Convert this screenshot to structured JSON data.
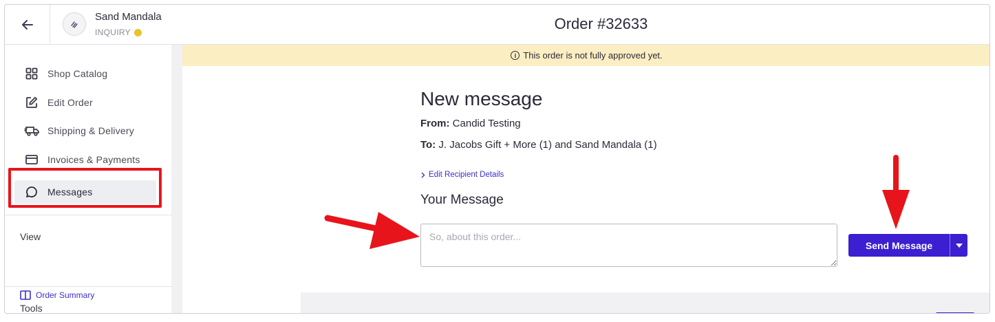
{
  "header": {
    "back_icon": "arrow-left-icon",
    "shop_name": "Sand Mandala",
    "shop_status": "INQUIRY",
    "status_color": "#e9c32a",
    "order_title": "Order #32633"
  },
  "sidebar": {
    "items": [
      {
        "label": "Shop Catalog",
        "icon": "grid-icon"
      },
      {
        "label": "Edit Order",
        "icon": "edit-icon"
      },
      {
        "label": "Shipping & Delivery",
        "icon": "truck-icon"
      },
      {
        "label": "Invoices & Payments",
        "icon": "card-icon"
      },
      {
        "label": "Messages",
        "icon": "chat-icon",
        "active": true
      }
    ],
    "view_label": "View",
    "order_summary_label": "Order Summary",
    "tools_label": "Tools"
  },
  "banner": {
    "text": "This order is not fully approved yet.",
    "info_glyph": "i"
  },
  "compose": {
    "title": "New message",
    "from_label": "From:",
    "from_value": "Candid Testing",
    "to_label": "To:",
    "to_value": "J. Jacobs Gift + More (1) and Sand Mandala (1)",
    "edit_recipients": "Edit Recipient Details",
    "your_message": "Your Message",
    "placeholder": "So, about this order...",
    "send_label": "Send Message"
  },
  "colors": {
    "accent": "#3b1fd0",
    "link": "#3b2fc9",
    "banner_bg": "#fbeec2",
    "annotation_red": "#e8141b"
  }
}
